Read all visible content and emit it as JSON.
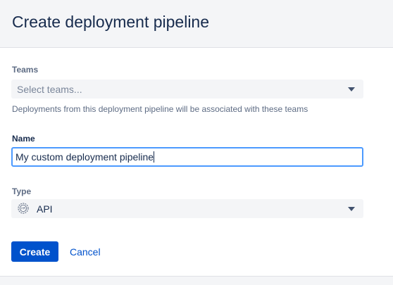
{
  "dialog": {
    "title": "Create deployment pipeline",
    "teams": {
      "label": "Teams",
      "placeholder": "Select teams...",
      "helper": "Deployments from this deployment pipeline will be associated with these teams"
    },
    "name": {
      "label": "Name",
      "value": "My custom deployment pipeline"
    },
    "type": {
      "label": "Type",
      "value": "API",
      "icon": "api-icon"
    },
    "actions": {
      "create": "Create",
      "cancel": "Cancel"
    }
  },
  "colors": {
    "primary": "#0052cc",
    "focus": "#4c9aff",
    "field_bg": "#f4f5f7"
  }
}
